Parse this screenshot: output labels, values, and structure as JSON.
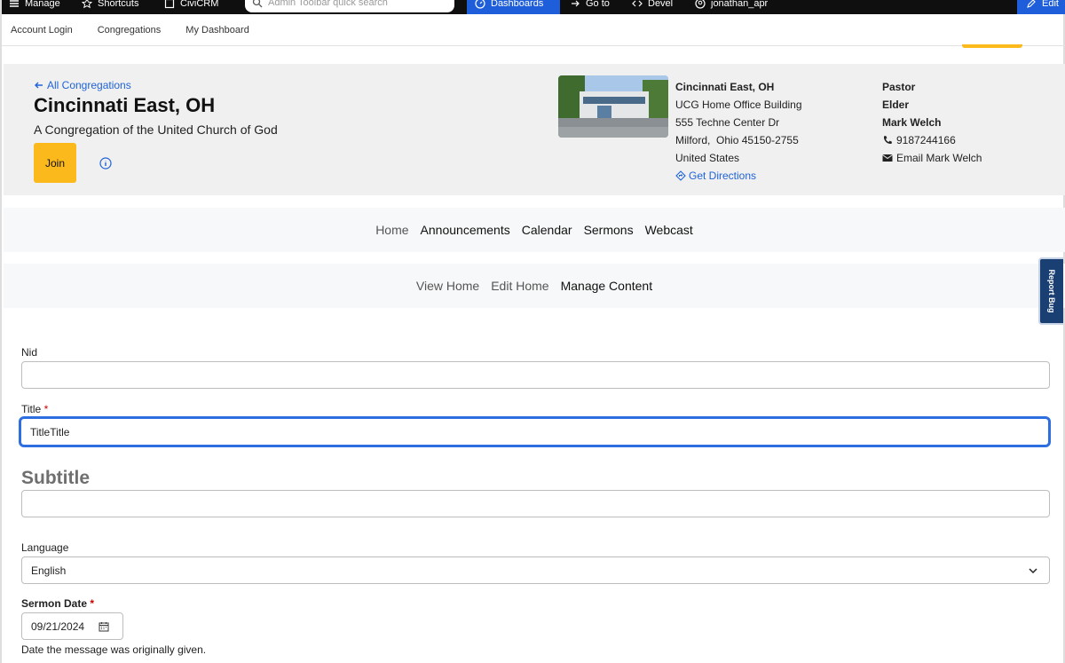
{
  "toolbar": {
    "manage": "Manage",
    "shortcuts": "Shortcuts",
    "civicrm": "CiviCRM",
    "search_placeholder": "Admin Toolbar quick search",
    "dashboards": "Dashboards",
    "goto": "Go to",
    "devel": "Devel",
    "user": "jonathan_apr",
    "edit": "Edit"
  },
  "secondary_nav": [
    "Account Login",
    "Congregations",
    "My Dashboard"
  ],
  "header": {
    "back_link": "All Congregations",
    "title": "Cincinnati East, OH",
    "subtitle": "A Congregation of the United Church of God",
    "join_label": "Join",
    "address": {
      "name": "Cincinnati East, OH",
      "building": "UCG Home Office Building",
      "street": "555 Techne Center Dr",
      "city": "Milford,",
      "state_zip": "Ohio 45150-2755",
      "country": "United States",
      "directions": "Get Directions"
    },
    "pastor": {
      "role1": "Pastor",
      "role2": "Elder",
      "name": "Mark Welch",
      "phone": "9187244166",
      "email_label": "Email Mark Welch"
    }
  },
  "primary_tabs": [
    "Home",
    "Announcements",
    "Calendar",
    "Sermons",
    "Webcast"
  ],
  "secondary_tabs": [
    "View Home",
    "Edit Home",
    "Manage Content"
  ],
  "report_bug": "Report Bug",
  "form": {
    "nid_label": "Nid",
    "nid_value": "",
    "title_label": "Title",
    "title_value": "TitleTitle",
    "subtitle_heading": "Subtitle",
    "subtitle_value": "",
    "language_label": "Language",
    "language_value": "English",
    "sermon_date_label": "Sermon Date",
    "sermon_date_value": "09/21/2024",
    "sermon_date_help": "Date the message was originally given.",
    "required_marker": "*"
  },
  "colors": {
    "accent": "#fbb91b",
    "link": "#1f63d7",
    "focus": "#2d6ee0",
    "toolbar": "#0f0f0f",
    "toolbar_active": "#1f5edb"
  }
}
